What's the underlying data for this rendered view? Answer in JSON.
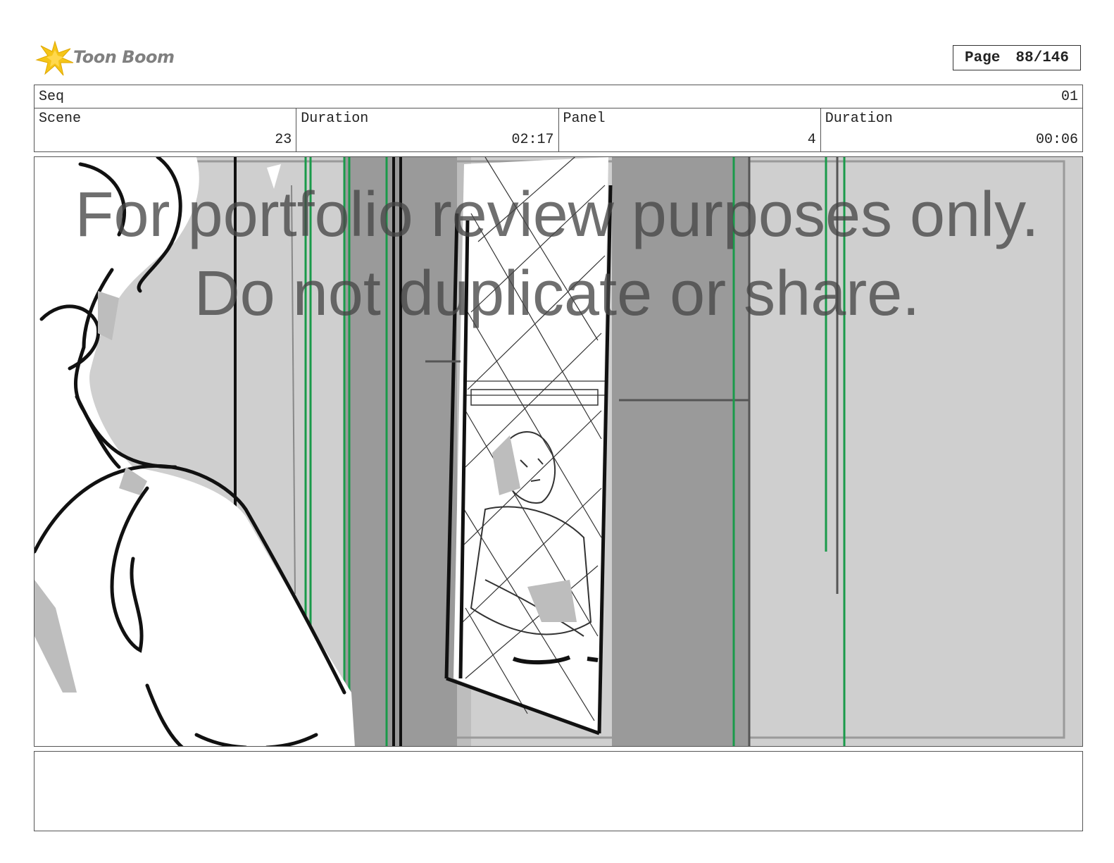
{
  "header": {
    "brand": "Toon Boom",
    "page_label": "Page",
    "page_number": "88/146"
  },
  "info": {
    "seq_label": "Seq",
    "seq_value": "01",
    "scene_label": "Scene",
    "scene_value": "23",
    "scene_duration_label": "Duration",
    "scene_duration_value": "02:17",
    "panel_label": "Panel",
    "panel_value": "4",
    "panel_duration_label": "Duration",
    "panel_duration_value": "00:06"
  },
  "watermark": {
    "line1": "For portfolio review purposes only.",
    "line2": "Do not duplicate or share."
  },
  "colors": {
    "guide_green": "#1a9a4a",
    "light_gray": "#cfcfcf",
    "dark_gray": "#9a9a9a",
    "logo_yellow": "#f5c518"
  },
  "notes": {
    "text": ""
  }
}
